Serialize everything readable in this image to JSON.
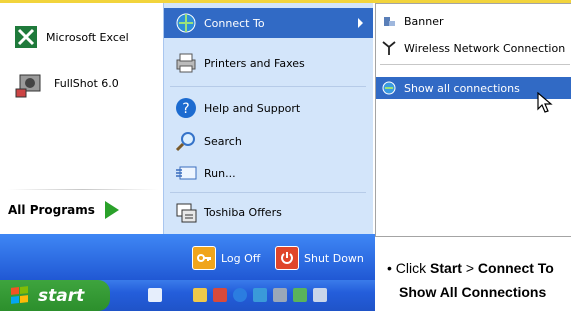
{
  "left_column": {
    "pinned": [
      {
        "label": "Microsoft Excel",
        "icon": "excel-icon"
      },
      {
        "label": "FullShot 6.0",
        "icon": "fullshot-icon"
      }
    ],
    "all_programs_label": "All Programs"
  },
  "right_column": {
    "items": [
      {
        "label": "Connect To",
        "icon": "connect-to-icon",
        "highlighted": true
      },
      {
        "label": "Printers and Faxes",
        "icon": "printer-icon"
      },
      {
        "label": "Help and Support",
        "icon": "help-icon"
      },
      {
        "label": "Search",
        "icon": "search-icon"
      },
      {
        "label": "Run...",
        "icon": "run-icon"
      },
      {
        "label": "Toshiba Offers",
        "icon": "toshiba-offers-icon"
      }
    ]
  },
  "bottom_bar": {
    "log_off_label": "Log Off",
    "shut_down_label": "Shut Down"
  },
  "taskbar": {
    "start_label": "start"
  },
  "connect_submenu": {
    "items": [
      {
        "label": "Banner",
        "icon": "network-icon"
      },
      {
        "label": "Wireless Network Connection",
        "icon": "antenna-icon"
      },
      {
        "label": "Show all connections",
        "icon": "network-connections-icon",
        "highlighted": true
      }
    ]
  },
  "instruction": {
    "bullet": "•",
    "line1_prefix": "Click",
    "start_word": "Start",
    "separator": ">",
    "connect_word": "Connect To",
    "line2_bold": "Show All Connections"
  },
  "colors": {
    "highlight": "#316ac5",
    "menu_right_bg": "#d3e5fa",
    "taskbar_blue": "#245edb",
    "start_green": "#3ea43e"
  }
}
